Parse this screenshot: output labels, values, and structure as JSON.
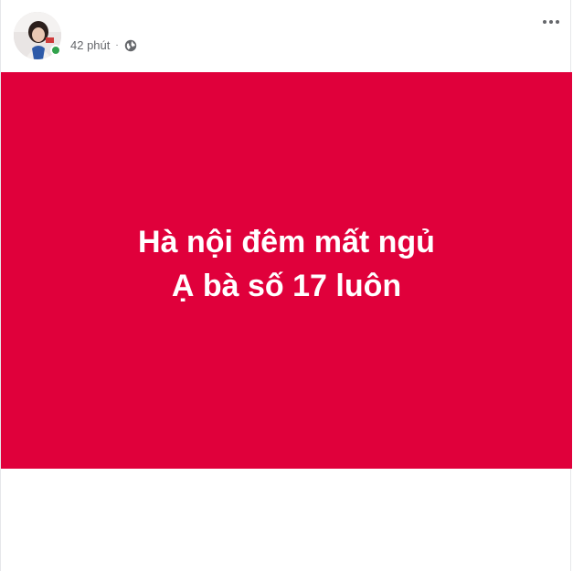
{
  "post": {
    "timestamp": "42 phút",
    "privacy_icon": "globe-icon",
    "more_icon": "more-options-icon",
    "online_status_color": "#31a24c",
    "background_color": "#e0003b",
    "text_lines": [
      "Hà nội đêm mất ngủ",
      "Ạ bà số 17 luôn"
    ]
  }
}
